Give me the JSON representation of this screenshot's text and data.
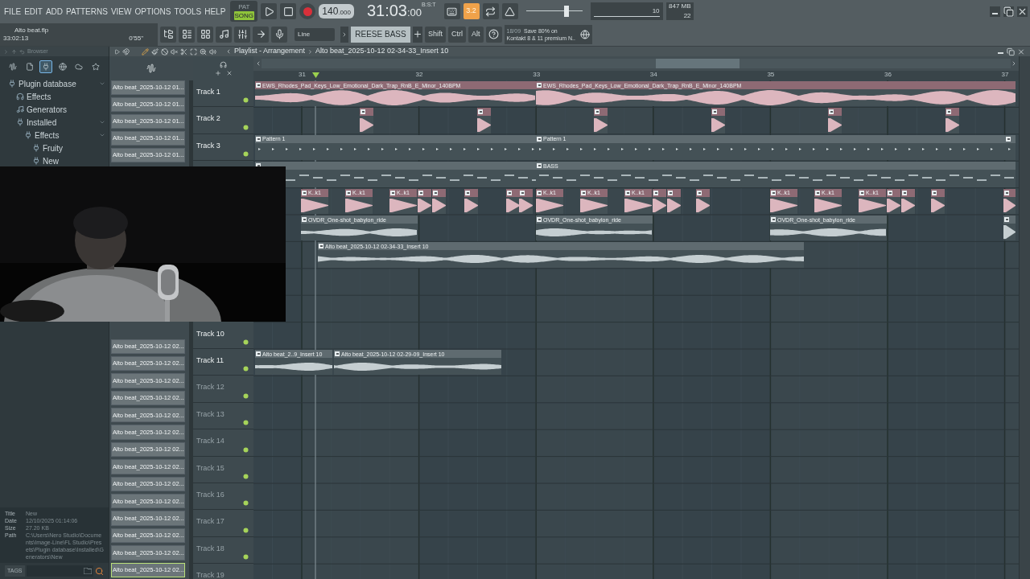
{
  "menu": [
    "FILE",
    "EDIT",
    "ADD",
    "PATTERNS",
    "VIEW",
    "OPTIONS",
    "TOOLS",
    "HELP"
  ],
  "transport": {
    "modes": [
      {
        "label": "PAT",
        "selected": false
      },
      {
        "label": "SONG",
        "selected": true
      }
    ],
    "tempo": "140",
    "tempo_fraction": ".000",
    "time": "31:03",
    "time_ticks": ":00",
    "time_format": "B:S:T"
  },
  "toolbar": {
    "snap": "3.2",
    "master_volume": {
      "level": 0.72
    },
    "cpu": "10",
    "memory": "847 MB",
    "polyphony": "22"
  },
  "project": {
    "name": "Alto beat.flp",
    "time": "33:02:13",
    "duration": "0'55\""
  },
  "tools": {
    "draw_mode": "Line",
    "pattern": "REESE BASS",
    "modifiers": [
      "Shift",
      "Ctrl",
      "Alt"
    ],
    "news_date": "18/09",
    "news_lines": [
      "Save 80% on",
      "Kontakt 8 & 11 premium N.."
    ]
  },
  "browser": {
    "title": "Browser",
    "tabs": [
      {
        "kind": "waveform",
        "selected": false
      },
      {
        "kind": "file",
        "selected": false
      },
      {
        "kind": "plugin",
        "selected": true
      },
      {
        "kind": "globe",
        "selected": false
      },
      {
        "kind": "cloud",
        "selected": false
      },
      {
        "kind": "star",
        "selected": false
      }
    ],
    "tree": [
      {
        "label": "Plugin database",
        "kind": "plugin",
        "expanded": true,
        "children": [
          {
            "label": "Effects",
            "kind": "effect"
          },
          {
            "label": "Generators",
            "kind": "generator"
          },
          {
            "label": "Installed",
            "kind": "plugin",
            "expanded": true,
            "children": [
              {
                "label": "Effects",
                "kind": "plugin",
                "expanded": true,
                "children": [
                  {
                    "label": "Fruity",
                    "kind": "plugin"
                  },
                  {
                    "label": "New",
                    "kind": "plugin"
                  }
                ]
              }
            ]
          }
        ]
      }
    ],
    "info": [
      {
        "label": "Title",
        "value": "New"
      },
      {
        "label": "Date",
        "value": "12/10/2025 01:14:06"
      },
      {
        "label": "Size",
        "value": "27.20 KB"
      },
      {
        "label": "Path",
        "value": "C:\\Users\\Nero Studio\\Documents\\Image-Line\\FL Studio\\Presets\\Plugin database\\Installed\\Generators\\New"
      }
    ],
    "tags_button": "TAGS"
  },
  "playlist": {
    "title": "Playlist - Arrangement",
    "breadcrumb": "Alto beat_2025-10-12 02-34-33_Insert 10",
    "ruler": [
      "31",
      "32",
      "33",
      "34",
      "35",
      "36",
      "37"
    ],
    "patterns_top": [
      {
        "label": "Alto beat_2025-10-12 01...",
        "selected": false
      },
      {
        "label": "Alto beat_2025-10-12 01...",
        "selected": false
      },
      {
        "label": "Alto beat_2025-10-12 01...",
        "selected": false
      },
      {
        "label": "Alto beat_2025-10-12 01...",
        "selected": false
      },
      {
        "label": "Alto beat_2025-10-12 01...",
        "selected": false
      }
    ],
    "patterns_bottom": [
      {
        "label": "Alto beat_2025-10-12 02...",
        "selected": false
      },
      {
        "label": "Alto beat_2025-10-12 02...",
        "selected": false
      },
      {
        "label": "Alto beat_2025-10-12 02...",
        "selected": false
      },
      {
        "label": "Alto beat_2025-10-12 02...",
        "selected": false
      },
      {
        "label": "Alto beat_2025-10-12 02...",
        "selected": false
      },
      {
        "label": "Alto beat_2025-10-12 02...",
        "selected": false
      },
      {
        "label": "Alto beat_2025-10-12 02...",
        "selected": false
      },
      {
        "label": "Alto beat_2025-10-12 02...",
        "selected": false
      },
      {
        "label": "Alto beat_2025-10-12 02...",
        "selected": false
      },
      {
        "label": "Alto beat_2025-10-12 02...",
        "selected": false
      },
      {
        "label": "Alto beat_2025-10-12 02...",
        "selected": false
      },
      {
        "label": "Alto beat_2025-10-12 02...",
        "selected": false
      },
      {
        "label": "Alto beat_2025-10-12 02...",
        "selected": false
      },
      {
        "label": "Alto beat_2025-10-12 02...",
        "selected": true
      }
    ],
    "tracks": [
      {
        "label": "Track 1",
        "dimmed": false,
        "clips": [
          {
            "label": "EWS_Rhodes_Pad_Keys_Low_Emotional_Dark_Trap_RnB_E_Minor_140BPM",
            "kind": "audio",
            "color": "#8e6a74"
          },
          {
            "label": "EWS_Rhodes_Pad_Keys_Low_Emotional_Dark_Trap_RnB_E_Minor_140BPM",
            "kind": "audio",
            "color": "#8e6a74"
          }
        ]
      },
      {
        "label": "Track 2",
        "dimmed": false,
        "clips": [
          {
            "kind": "audio",
            "color": "#8e6a74"
          },
          {
            "kind": "audio",
            "color": "#8e6a74"
          },
          {
            "kind": "audio",
            "color": "#8e6a74"
          },
          {
            "kind": "audio",
            "color": "#8e6a74"
          },
          {
            "kind": "audio",
            "color": "#8e6a74"
          },
          {
            "kind": "audio",
            "color": "#8e6a74"
          }
        ]
      },
      {
        "label": "Track 3",
        "dimmed": false,
        "clips": [
          {
            "label": "Pattern 1",
            "kind": "pattern",
            "color": "#5f6b70"
          },
          {
            "label": "Pattern 1",
            "kind": "pattern",
            "color": "#5f6b70"
          },
          {
            "kind": "pattern",
            "color": "#5f6b70"
          }
        ]
      },
      {
        "clips": [
          {
            "kind": "pattern",
            "color": "#5f6b70"
          },
          {
            "label": "BASS",
            "kind": "pattern",
            "color": "#5f6b70"
          }
        ]
      },
      {
        "clips": [
          {
            "label": "K..k1",
            "kind": "audio",
            "color": "#8e6a74"
          },
          {
            "label": "K..k1",
            "kind": "audio",
            "color": "#8e6a74"
          },
          {
            "label": "K..k1",
            "kind": "audio",
            "color": "#8e6a74"
          },
          {
            "kind": "audio",
            "color": "#8e6a74"
          },
          {
            "kind": "audio",
            "color": "#8e6a74"
          },
          {
            "kind": "audio",
            "color": "#8e6a74"
          },
          {
            "kind": "audio",
            "color": "#8e6a74"
          },
          {
            "kind": "audio",
            "color": "#8e6a74"
          },
          {
            "label": "K..k1",
            "kind": "audio",
            "color": "#8e6a74"
          },
          {
            "label": "K..k1",
            "kind": "audio",
            "color": "#8e6a74"
          },
          {
            "label": "K..k1",
            "kind": "audio",
            "color": "#8e6a74"
          },
          {
            "kind": "audio",
            "color": "#8e6a74"
          },
          {
            "kind": "audio",
            "color": "#8e6a74"
          },
          {
            "kind": "audio",
            "color": "#8e6a74"
          },
          {
            "label": "K..k1",
            "kind": "audio",
            "color": "#8e6a74"
          },
          {
            "label": "K..k1",
            "kind": "audio",
            "color": "#8e6a74"
          },
          {
            "label": "K..k1",
            "kind": "audio",
            "color": "#8e6a74"
          },
          {
            "kind": "audio",
            "color": "#8e6a74"
          },
          {
            "kind": "audio",
            "color": "#8e6a74"
          },
          {
            "kind": "audio",
            "color": "#8e6a74"
          },
          {
            "kind": "audio",
            "color": "#8e6a74"
          }
        ]
      },
      {
        "clips": [
          {
            "label": "OVDR_One-shot_babylon_ride",
            "kind": "audio",
            "color": "#5f6b70"
          },
          {
            "label": "OVDR_One-shot_babylon_ride",
            "kind": "audio",
            "color": "#5f6b70"
          },
          {
            "label": "OVDR_One-shot_babylon_ride",
            "kind": "audio",
            "color": "#5f6b70"
          },
          {
            "kind": "audio",
            "color": "#5f6b70"
          }
        ]
      },
      {
        "clips": [
          {
            "label": "Alto beat_2025-10-12 02-34-33_Insert 10",
            "kind": "audio",
            "color": "#5f6b70"
          }
        ]
      },
      {
        "label": "Track 10",
        "dimmed": false
      },
      {
        "label": "Track 11",
        "dimmed": false,
        "clips": [
          {
            "label": "Alto beat_2..9_Insert 10",
            "kind": "audio",
            "color": "#5f6b70"
          },
          {
            "label": "Alto beat_2025-10-12 02-29-09_Insert 10",
            "kind": "audio",
            "color": "#5f6b70"
          }
        ]
      },
      {
        "label": "Track 12",
        "dimmed": true
      },
      {
        "label": "Track 13",
        "dimmed": true
      },
      {
        "label": "Track 14",
        "dimmed": true
      },
      {
        "label": "Track 15",
        "dimmed": true
      },
      {
        "label": "Track 16",
        "dimmed": true
      },
      {
        "label": "Track 17",
        "dimmed": true
      },
      {
        "label": "Track 18",
        "dimmed": true
      },
      {
        "label": "Track 19",
        "dimmed": true
      }
    ]
  }
}
